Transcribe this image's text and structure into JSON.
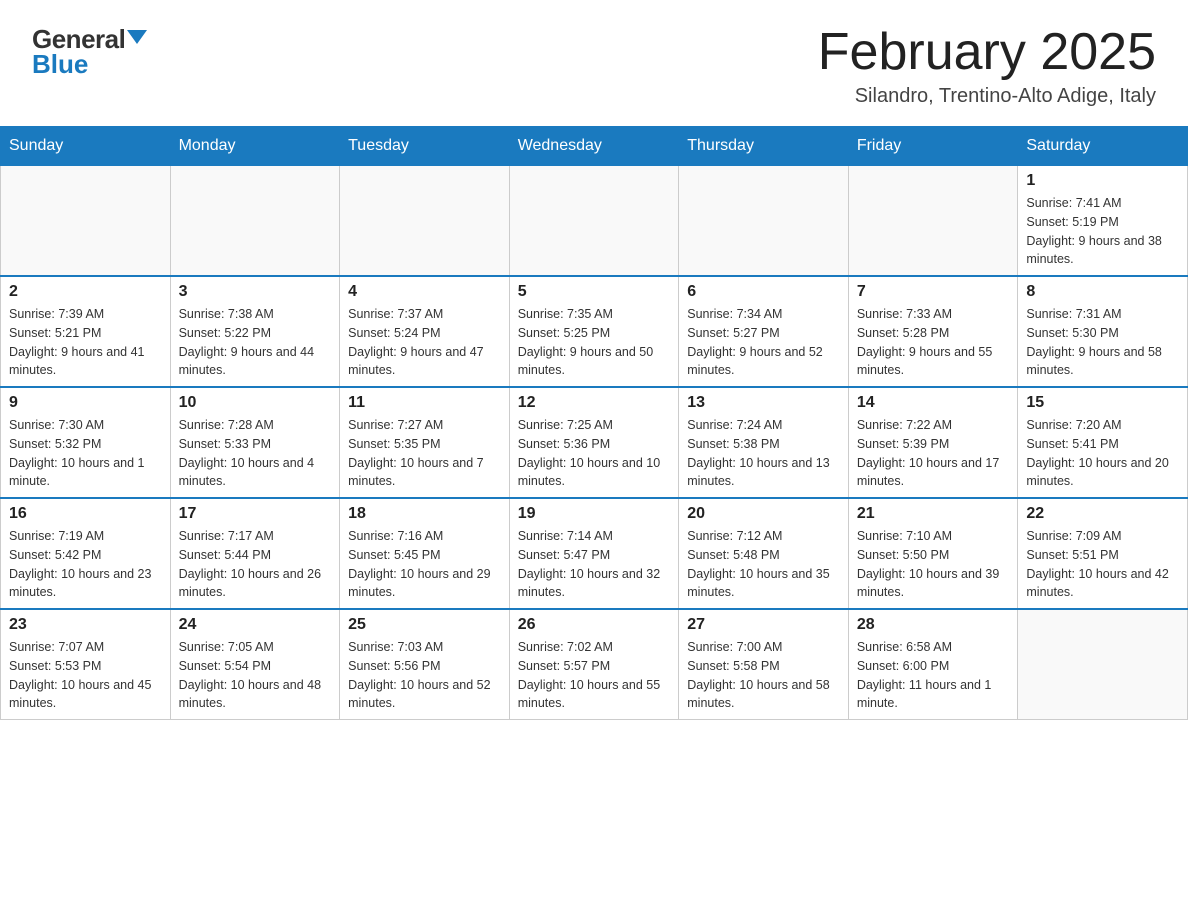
{
  "header": {
    "logo_general": "General",
    "logo_blue": "Blue",
    "month_title": "February 2025",
    "location": "Silandro, Trentino-Alto Adige, Italy"
  },
  "days_of_week": [
    "Sunday",
    "Monday",
    "Tuesday",
    "Wednesday",
    "Thursday",
    "Friday",
    "Saturday"
  ],
  "weeks": [
    [
      {
        "day": "",
        "info": ""
      },
      {
        "day": "",
        "info": ""
      },
      {
        "day": "",
        "info": ""
      },
      {
        "day": "",
        "info": ""
      },
      {
        "day": "",
        "info": ""
      },
      {
        "day": "",
        "info": ""
      },
      {
        "day": "1",
        "info": "Sunrise: 7:41 AM\nSunset: 5:19 PM\nDaylight: 9 hours and 38 minutes."
      }
    ],
    [
      {
        "day": "2",
        "info": "Sunrise: 7:39 AM\nSunset: 5:21 PM\nDaylight: 9 hours and 41 minutes."
      },
      {
        "day": "3",
        "info": "Sunrise: 7:38 AM\nSunset: 5:22 PM\nDaylight: 9 hours and 44 minutes."
      },
      {
        "day": "4",
        "info": "Sunrise: 7:37 AM\nSunset: 5:24 PM\nDaylight: 9 hours and 47 minutes."
      },
      {
        "day": "5",
        "info": "Sunrise: 7:35 AM\nSunset: 5:25 PM\nDaylight: 9 hours and 50 minutes."
      },
      {
        "day": "6",
        "info": "Sunrise: 7:34 AM\nSunset: 5:27 PM\nDaylight: 9 hours and 52 minutes."
      },
      {
        "day": "7",
        "info": "Sunrise: 7:33 AM\nSunset: 5:28 PM\nDaylight: 9 hours and 55 minutes."
      },
      {
        "day": "8",
        "info": "Sunrise: 7:31 AM\nSunset: 5:30 PM\nDaylight: 9 hours and 58 minutes."
      }
    ],
    [
      {
        "day": "9",
        "info": "Sunrise: 7:30 AM\nSunset: 5:32 PM\nDaylight: 10 hours and 1 minute."
      },
      {
        "day": "10",
        "info": "Sunrise: 7:28 AM\nSunset: 5:33 PM\nDaylight: 10 hours and 4 minutes."
      },
      {
        "day": "11",
        "info": "Sunrise: 7:27 AM\nSunset: 5:35 PM\nDaylight: 10 hours and 7 minutes."
      },
      {
        "day": "12",
        "info": "Sunrise: 7:25 AM\nSunset: 5:36 PM\nDaylight: 10 hours and 10 minutes."
      },
      {
        "day": "13",
        "info": "Sunrise: 7:24 AM\nSunset: 5:38 PM\nDaylight: 10 hours and 13 minutes."
      },
      {
        "day": "14",
        "info": "Sunrise: 7:22 AM\nSunset: 5:39 PM\nDaylight: 10 hours and 17 minutes."
      },
      {
        "day": "15",
        "info": "Sunrise: 7:20 AM\nSunset: 5:41 PM\nDaylight: 10 hours and 20 minutes."
      }
    ],
    [
      {
        "day": "16",
        "info": "Sunrise: 7:19 AM\nSunset: 5:42 PM\nDaylight: 10 hours and 23 minutes."
      },
      {
        "day": "17",
        "info": "Sunrise: 7:17 AM\nSunset: 5:44 PM\nDaylight: 10 hours and 26 minutes."
      },
      {
        "day": "18",
        "info": "Sunrise: 7:16 AM\nSunset: 5:45 PM\nDaylight: 10 hours and 29 minutes."
      },
      {
        "day": "19",
        "info": "Sunrise: 7:14 AM\nSunset: 5:47 PM\nDaylight: 10 hours and 32 minutes."
      },
      {
        "day": "20",
        "info": "Sunrise: 7:12 AM\nSunset: 5:48 PM\nDaylight: 10 hours and 35 minutes."
      },
      {
        "day": "21",
        "info": "Sunrise: 7:10 AM\nSunset: 5:50 PM\nDaylight: 10 hours and 39 minutes."
      },
      {
        "day": "22",
        "info": "Sunrise: 7:09 AM\nSunset: 5:51 PM\nDaylight: 10 hours and 42 minutes."
      }
    ],
    [
      {
        "day": "23",
        "info": "Sunrise: 7:07 AM\nSunset: 5:53 PM\nDaylight: 10 hours and 45 minutes."
      },
      {
        "day": "24",
        "info": "Sunrise: 7:05 AM\nSunset: 5:54 PM\nDaylight: 10 hours and 48 minutes."
      },
      {
        "day": "25",
        "info": "Sunrise: 7:03 AM\nSunset: 5:56 PM\nDaylight: 10 hours and 52 minutes."
      },
      {
        "day": "26",
        "info": "Sunrise: 7:02 AM\nSunset: 5:57 PM\nDaylight: 10 hours and 55 minutes."
      },
      {
        "day": "27",
        "info": "Sunrise: 7:00 AM\nSunset: 5:58 PM\nDaylight: 10 hours and 58 minutes."
      },
      {
        "day": "28",
        "info": "Sunrise: 6:58 AM\nSunset: 6:00 PM\nDaylight: 11 hours and 1 minute."
      },
      {
        "day": "",
        "info": ""
      }
    ]
  ]
}
